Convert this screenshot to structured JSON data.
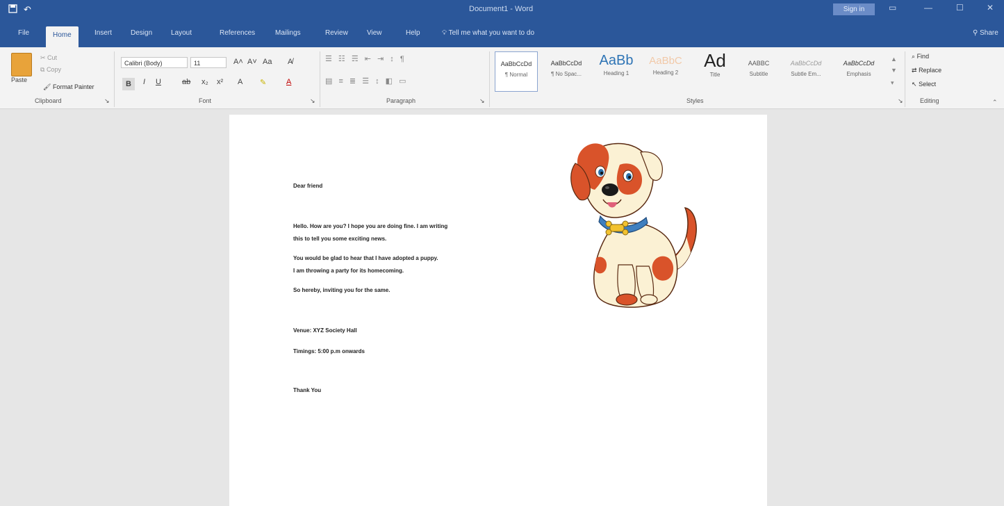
{
  "titlebar": {
    "qat_label": "",
    "doc_title": "Document1 - Word",
    "signin": "Sign in"
  },
  "tabs": [
    {
      "label": "File"
    },
    {
      "label": "Home"
    },
    {
      "label": "Insert"
    },
    {
      "label": "Design"
    },
    {
      "label": "Layout"
    },
    {
      "label": "References"
    },
    {
      "label": "Mailings"
    },
    {
      "label": "Review"
    },
    {
      "label": "View"
    },
    {
      "label": "Help"
    }
  ],
  "tellme": "Tell me what you want to do",
  "share": "Share",
  "clipboard": {
    "paste": "Paste",
    "cut": "Cut",
    "copy": "Copy",
    "format_painter": "Format Painter",
    "label": "Clipboard"
  },
  "font": {
    "name": "Calibri (Body)",
    "size": "11",
    "label": "Font"
  },
  "paragraph": {
    "label": "Paragraph"
  },
  "styles": {
    "label": "Styles",
    "items": [
      {
        "preview": "AaBbCcDd",
        "name": "¶ Normal"
      },
      {
        "preview": "AaBbCcDd",
        "name": "¶ No Spac..."
      },
      {
        "preview": "AaBb",
        "name": "Heading 1"
      },
      {
        "preview": "AaBbC",
        "name": "Heading 2"
      },
      {
        "preview": "Ad",
        "name": "Title"
      },
      {
        "preview": "AABBC",
        "name": "Subtitle"
      },
      {
        "preview": "AaBbCcDd",
        "name": "Subtle Em..."
      },
      {
        "preview": "AaBbCcDd",
        "name": "Emphasis"
      }
    ]
  },
  "editing": {
    "find": "Find",
    "replace": "Replace",
    "select": "Select",
    "label": "Editing"
  },
  "document": {
    "greeting": "Dear friend",
    "para1_line1": "Hello. How are you? I hope you are doing fine. I am writing",
    "para1_line2": "this to tell you some exciting news.",
    "para2_line1": "You would be glad to hear that I have adopted a puppy.",
    "para2_line2": "I am throwing a party for its homecoming.",
    "para3": "So hereby, inviting you for the same.",
    "venue": "Venue: XYZ Society Hall",
    "timings": "Timings: 5:00 p.m onwards",
    "closing": "Thank You"
  },
  "colors": {
    "brand_blue": "#2b579a",
    "ribbon_bg": "#f3f3f3",
    "canvas_bg": "#e6e6e6"
  }
}
